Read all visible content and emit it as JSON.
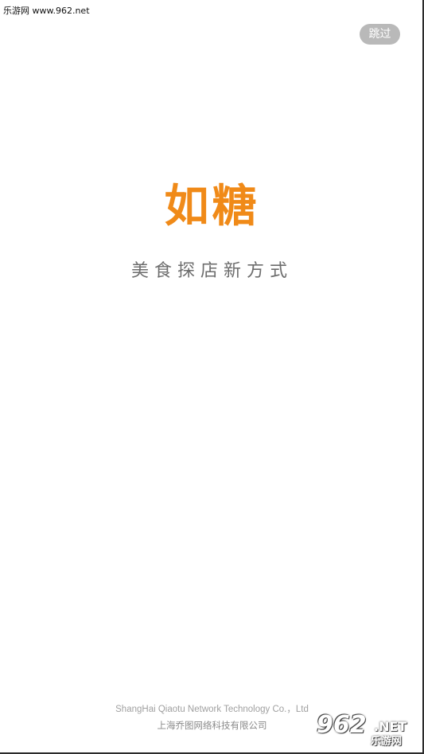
{
  "watermark_top": {
    "text": "乐游网 www.962.net"
  },
  "skip_button": {
    "label": "跳过"
  },
  "brand": {
    "logo_text": "如糖",
    "tagline": "美食探店新方式",
    "logo_color": "#f08a18"
  },
  "footer": {
    "company_en": "ShangHai Qiaotu Network Technology Co.，Ltd",
    "company_cn": "上海乔图网络科技有限公司"
  },
  "watermark_bottom": {
    "number": "962",
    "domain": ".NET",
    "name": "乐游网"
  }
}
